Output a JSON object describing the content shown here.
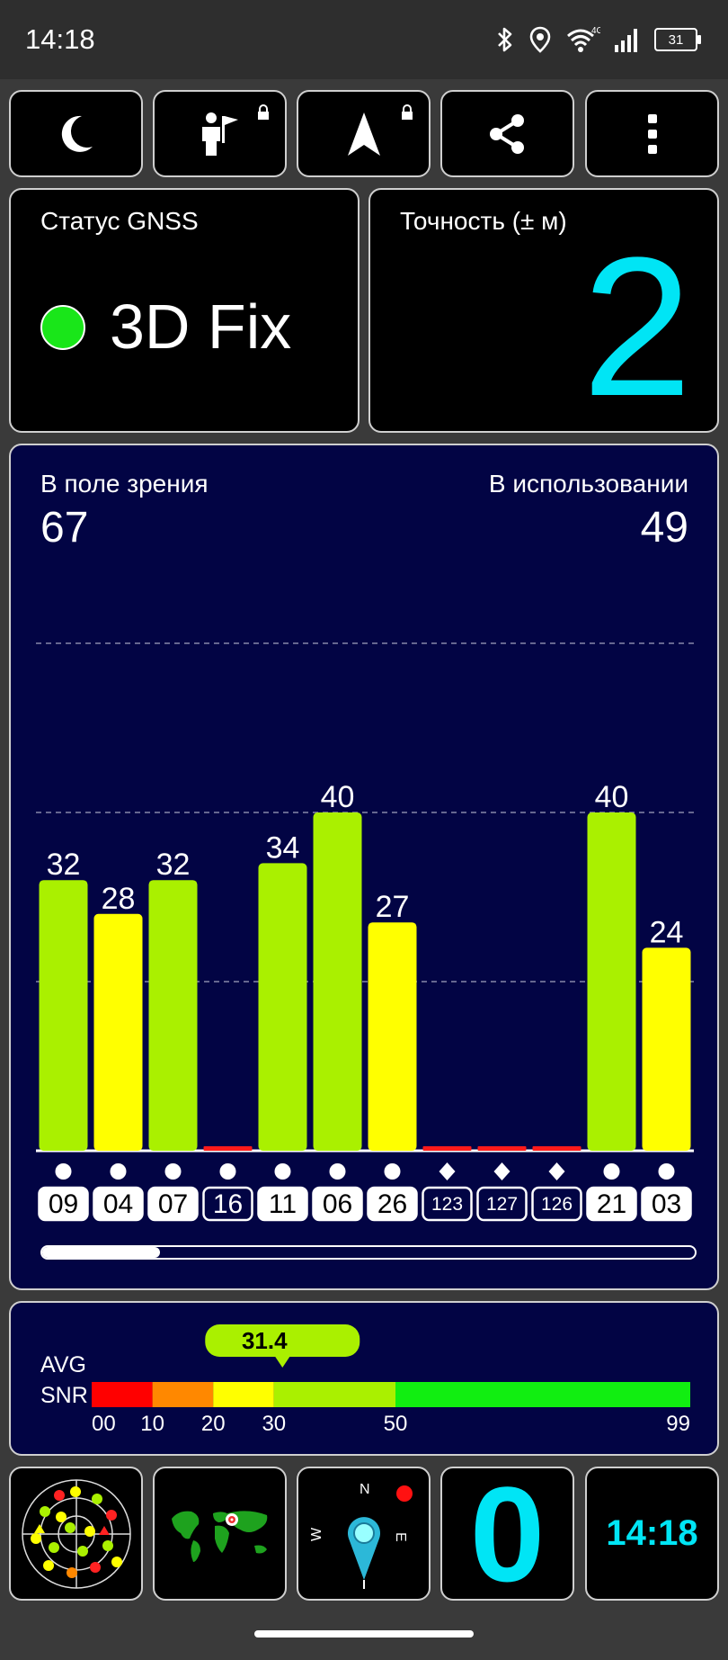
{
  "status_bar": {
    "time": "14:18",
    "network_label": "4G",
    "battery": "31",
    "icons": [
      "bluetooth-icon",
      "location-icon",
      "wifi-icon",
      "signal-icon",
      "battery-icon"
    ]
  },
  "toolbar": {
    "buttons": [
      "night-mode-button",
      "explorer-button",
      "navigate-button",
      "share-button",
      "more-menu-button"
    ]
  },
  "gnss_status": {
    "title": "Статус GNSS",
    "value": "3D Fix",
    "indicator_color": "#19e619"
  },
  "accuracy": {
    "title": "Точность (± м)",
    "value": "2",
    "color": "#00e5f5"
  },
  "satellites": {
    "in_view_label": "В поле зрения",
    "in_view": "67",
    "in_use_label": "В использовании",
    "in_use": "49"
  },
  "chart_data": {
    "type": "bar",
    "categories": [
      "09",
      "04",
      "07",
      "16",
      "11",
      "06",
      "26",
      "123",
      "127",
      "126",
      "21",
      "03"
    ],
    "values": [
      32,
      28,
      32,
      0,
      34,
      40,
      27,
      0,
      0,
      0,
      40,
      24
    ],
    "labels_shown": [
      "32",
      "28",
      "32",
      "",
      "34",
      "40",
      "27",
      "",
      "",
      "",
      "40",
      "24"
    ],
    "in_use": [
      true,
      true,
      true,
      false,
      true,
      true,
      true,
      false,
      false,
      false,
      true,
      true
    ],
    "markers": [
      "circle",
      "circle",
      "circle",
      "circle",
      "circle",
      "circle",
      "circle",
      "diamond",
      "diamond",
      "diamond",
      "circle",
      "circle"
    ],
    "ylim": [
      0,
      60
    ],
    "grid": [
      20,
      40,
      60
    ],
    "colors": {
      "high": "#aaf000",
      "mid": "#ffff00",
      "low": "#ff1a1a"
    },
    "scroll_fraction": 0.18
  },
  "snr": {
    "label_line1": "AVG",
    "label_line2": "SNR",
    "avg": "31.4",
    "avg_value": 31.4,
    "ticks": [
      "00",
      "10",
      "20",
      "30",
      "50",
      "99"
    ],
    "segments": [
      {
        "from": 0,
        "to": 10,
        "color": "#ff0000"
      },
      {
        "from": 10,
        "to": 20,
        "color": "#ff8800"
      },
      {
        "from": 20,
        "to": 30,
        "color": "#ffff00"
      },
      {
        "from": 30,
        "to": 50,
        "color": "#aaf000"
      },
      {
        "from": 50,
        "to": 99,
        "color": "#11ee11"
      }
    ]
  },
  "bottom_tiles": {
    "compass_letters": [
      "N",
      "E",
      "W"
    ],
    "speed": "0",
    "clock": "14:18"
  }
}
